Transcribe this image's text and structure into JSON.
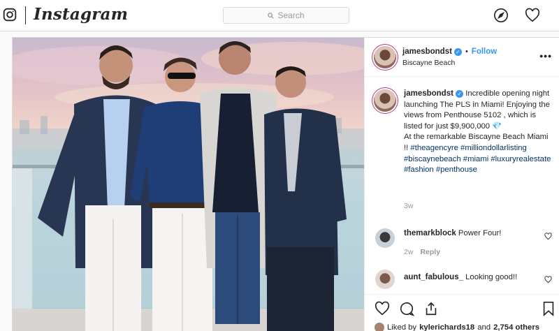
{
  "nav": {
    "wordmark": "Instagram",
    "search_placeholder": "Search",
    "icons": [
      "instagram-camera-icon",
      "search-icon",
      "explore-compass-icon",
      "activity-heart-icon"
    ]
  },
  "post": {
    "author": "jamesbondst",
    "follow_label": "Follow",
    "location": "Biscayne Beach",
    "more_label": "•••",
    "caption": {
      "text_1": "Incredible opening night launching The PLS in Miami! Enjoying the views from Penthouse 5102 , which is listed for just $9,900,000",
      "gem": "💎",
      "text_2": "At the remarkable Biscayne Beach Miami !!",
      "tag_theagencyre": "#theagencyre",
      "tag_milliondollarlisting": "#milliondollarlisting",
      "tag_biscaynebeach": "#biscaynebeach",
      "tag_miami": "#miami",
      "tag_luxuryrealestate": "#luxuryrealestate",
      "tag_fashion": "#fashion",
      "tag_penthouse": "#penthouse",
      "time": "3w"
    },
    "comments": [
      {
        "user": "themarkblock",
        "text": "Power Four!",
        "time": "2w",
        "reply_label": "Reply"
      },
      {
        "user": "aunt_fabulous_",
        "text": "Looking good!!"
      }
    ],
    "likes": {
      "prefix": "Liked by",
      "user": "kylerichards18",
      "and": "and",
      "others": "2,754 others"
    }
  },
  "colors": {
    "accent": "#3897f0",
    "hashtag": "#003569",
    "muted": "#999999"
  }
}
